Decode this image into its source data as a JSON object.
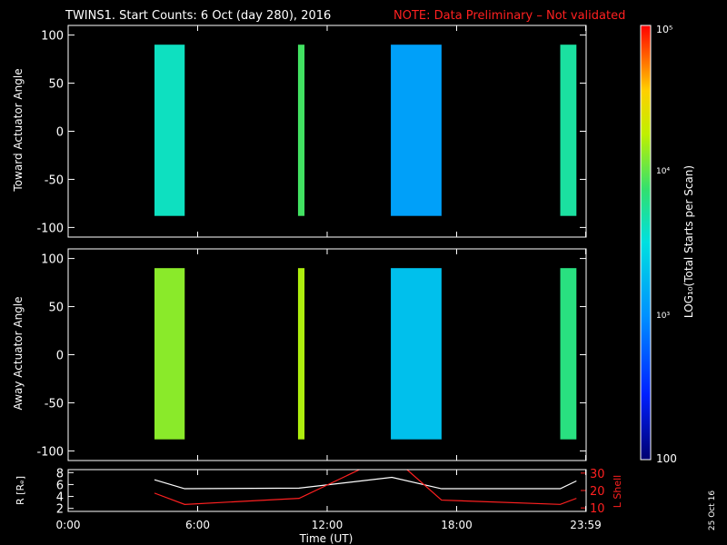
{
  "title": {
    "main": "TWINS1. Start Counts:  6 Oct (day 280), 2016",
    "note": "NOTE: Data Preliminary – Not validated"
  },
  "colorbar": {
    "label": "LOG₁₀(Total Starts per Scan)",
    "tick_labels": [
      "10⁵",
      "10⁴",
      "10³",
      "100"
    ],
    "log_range": [
      2,
      5
    ]
  },
  "footer_date": "25 Oct 16",
  "chart_data": [
    {
      "type": "heatmap",
      "panel": "toward",
      "ylabel": "Toward Actuator Angle",
      "ylim": [
        -110,
        110
      ],
      "yticks": [
        -100,
        -50,
        0,
        50,
        100
      ],
      "xlim": [
        0,
        24
      ],
      "angle_range": [
        -88,
        90
      ],
      "intervals": [
        {
          "start": 4.0,
          "end": 5.4,
          "log_counts": 3.6
        },
        {
          "start": 10.65,
          "end": 10.95,
          "log_counts": 3.9
        },
        {
          "start": 14.95,
          "end": 17.3,
          "log_counts": 3.1
        },
        {
          "start": 22.8,
          "end": 23.55,
          "log_counts": 3.7
        }
      ]
    },
    {
      "type": "heatmap",
      "panel": "away",
      "ylabel": "Away Actuator Angle",
      "ylim": [
        -110,
        110
      ],
      "yticks": [
        -100,
        -50,
        0,
        50,
        100
      ],
      "xlim": [
        0,
        24
      ],
      "angle_range": [
        -88,
        90
      ],
      "intervals": [
        {
          "start": 4.0,
          "end": 5.4,
          "log_counts": 4.1
        },
        {
          "start": 10.65,
          "end": 10.95,
          "log_counts": 4.2
        },
        {
          "start": 14.95,
          "end": 17.3,
          "log_counts": 3.3
        },
        {
          "start": 22.8,
          "end": 23.55,
          "log_counts": 3.8
        }
      ]
    },
    {
      "type": "line",
      "panel": "orbit",
      "xlabel": "Time (UT)",
      "x_tick_labels": [
        "0:00",
        "6:00",
        "12:00",
        "18:00",
        "23:59"
      ],
      "x_ticks": [
        0,
        6,
        12,
        18,
        23.98
      ],
      "ylabel_left": "R [Rₑ]",
      "ylim_left": [
        1.5,
        8.5
      ],
      "yticks_left": [
        2,
        4,
        6,
        8
      ],
      "ylabel_right": "L Shell",
      "ylim_right": [
        8,
        32
      ],
      "yticks_right": [
        10,
        20,
        30
      ],
      "series": [
        {
          "axis": "left",
          "color": "#ffffff",
          "x": [
            4.0,
            5.4,
            10.7,
            15.0,
            17.3,
            22.8,
            23.55
          ],
          "y": [
            6.8,
            5.3,
            5.4,
            7.2,
            5.3,
            5.3,
            6.6
          ]
        },
        {
          "axis": "right",
          "color": "#ff2020",
          "x": [
            4.0,
            5.4,
            10.7,
            13.5,
            15.0,
            15.7,
            17.3,
            22.8,
            23.55
          ],
          "y": [
            18.5,
            12.0,
            15.5,
            32.0,
            35.0,
            32.0,
            14.5,
            12.0,
            15.5
          ]
        }
      ]
    }
  ]
}
